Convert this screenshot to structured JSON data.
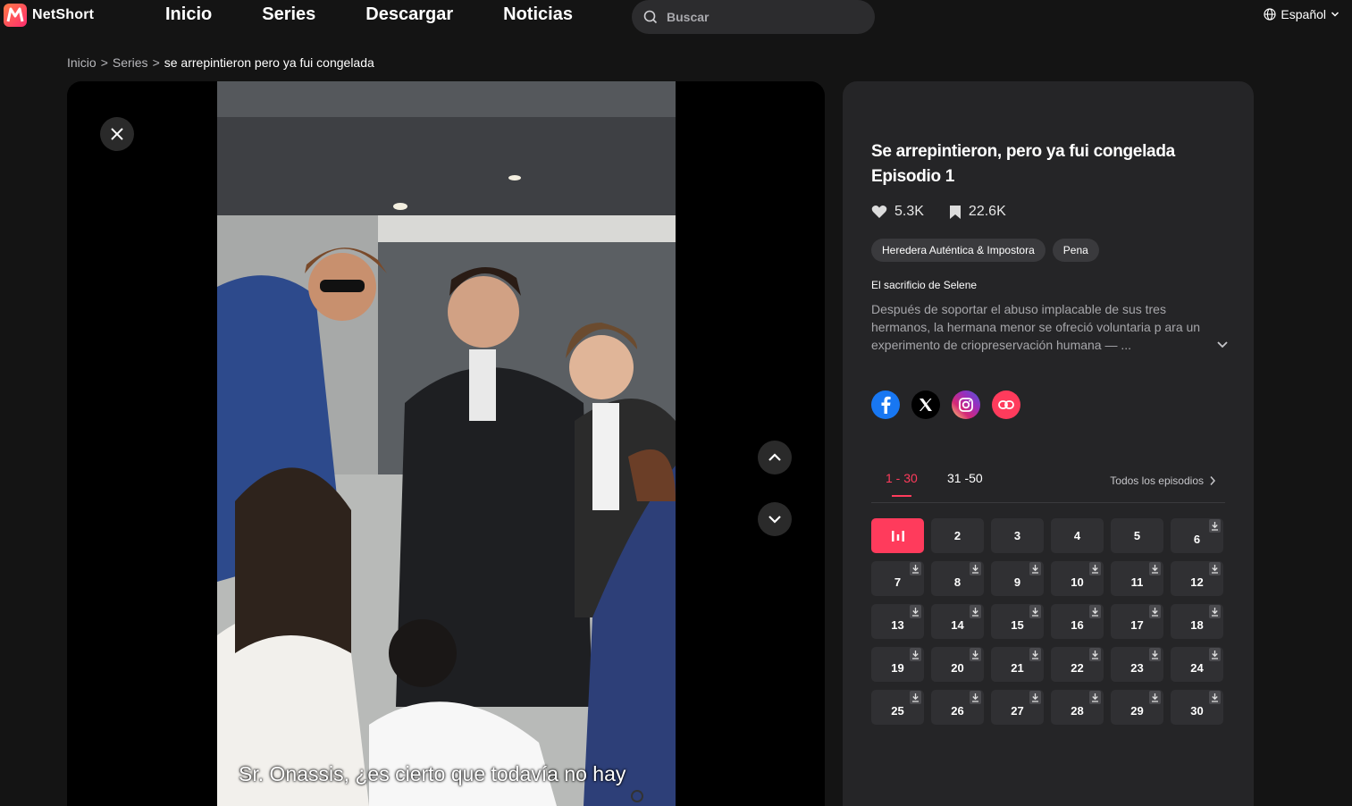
{
  "header": {
    "brand": "NetShort",
    "nav": [
      "Inicio",
      "Series",
      "Descargar",
      "Noticias"
    ],
    "search_placeholder": "Buscar",
    "language": "Español"
  },
  "breadcrumb": {
    "items": [
      "Inicio",
      "Series"
    ],
    "separator": ">",
    "current": "se arrepintieron pero ya fui congelada"
  },
  "player": {
    "subtitle": "Sr. Onassis, ¿es cierto que todavía no hay"
  },
  "details": {
    "title": "Se arrepintieron, pero ya fui congelada",
    "episode": "Episodio 1",
    "likes": "5.3K",
    "bookmarks": "22.6K",
    "tags": [
      "Heredera Auténtica & Impostora",
      "Pena"
    ],
    "subhead": "El sacrificio de Selene",
    "description": "Después de soportar el abuso implacable de sus tres hermanos, la hermana menor se ofreció voluntaria p ara un experimento de criopreservación humana — ..."
  },
  "episodes": {
    "tabs": [
      "1 - 30",
      "31 -50"
    ],
    "all_label": "Todos los episodios",
    "active": 1,
    "list": [
      1,
      2,
      3,
      4,
      5,
      6,
      7,
      8,
      9,
      10,
      11,
      12,
      13,
      14,
      15,
      16,
      17,
      18,
      19,
      20,
      21,
      22,
      23,
      24,
      25,
      26,
      27,
      28,
      29,
      30
    ],
    "with_download": [
      6,
      7,
      8,
      9,
      10,
      11,
      12,
      13,
      14,
      15,
      16,
      17,
      18,
      19,
      20,
      21,
      22,
      23,
      24,
      25,
      26,
      27,
      28,
      29,
      30
    ]
  },
  "colors": {
    "accent": "#ff3b5c",
    "background": "#141414",
    "panel": "#252527"
  }
}
